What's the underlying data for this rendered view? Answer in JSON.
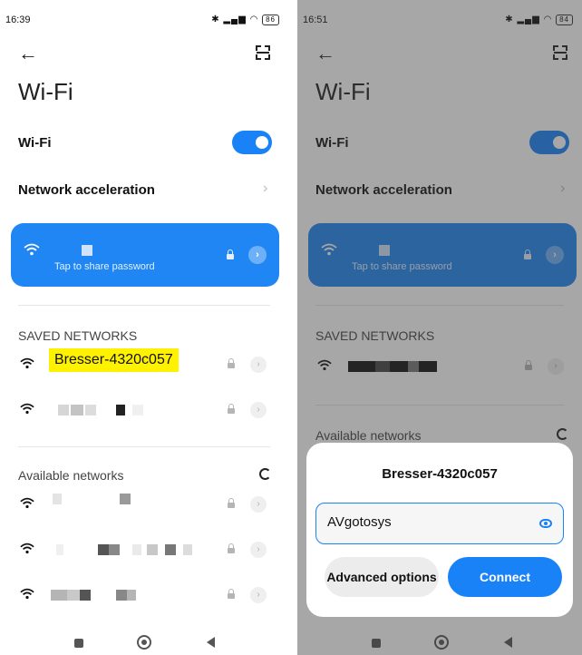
{
  "left": {
    "status": {
      "time": "16:39",
      "battery": "86"
    },
    "title": "Wi-Fi",
    "wifi_label": "Wi-Fi",
    "acceleration_label": "Network acceleration",
    "connected": {
      "share_text": "Tap to share password"
    },
    "saved_header": "SAVED NETWORKS",
    "saved_networks": [
      {
        "ssid": "Bresser-4320c057"
      }
    ],
    "available_header": "Available networks"
  },
  "right": {
    "status": {
      "time": "16:51",
      "battery": "84"
    },
    "title": "Wi-Fi",
    "wifi_label": "Wi-Fi",
    "acceleration_label": "Network acceleration",
    "connected": {
      "share_text": "Tap to share password"
    },
    "saved_header": "SAVED NETWORKS",
    "available_header": "Available networks",
    "dialog": {
      "title": "Bresser-4320c057",
      "password_value": "AVgotosys",
      "advanced_label": "Advanced options",
      "connect_label": "Connect"
    }
  },
  "colors": {
    "accent": "#1a82f7",
    "highlight": "#fff200"
  },
  "icons": [
    "back-arrow-icon",
    "scan-icon",
    "wifi-icon",
    "lock-icon",
    "chevron-right-icon",
    "refresh-icon",
    "eye-icon"
  ]
}
